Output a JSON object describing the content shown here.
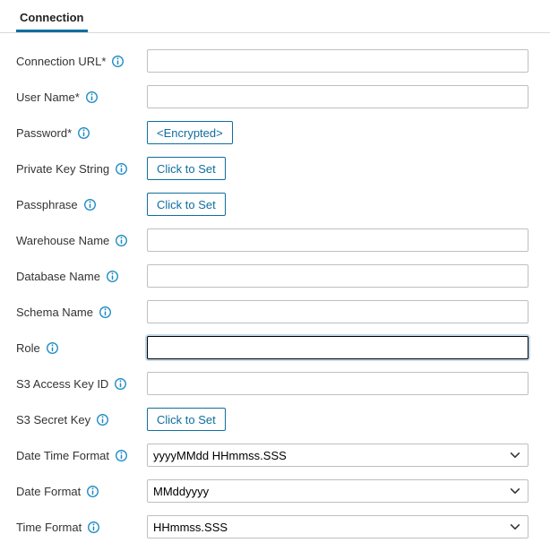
{
  "tabs": {
    "connection": "Connection"
  },
  "labels": {
    "connection_url": "Connection URL*",
    "user_name": "User Name*",
    "password": "Password*",
    "private_key_string": "Private Key String",
    "passphrase": "Passphrase",
    "warehouse_name": "Warehouse Name",
    "database_name": "Database Name",
    "schema_name": "Schema Name",
    "role": "Role",
    "s3_access_key_id": "S3 Access Key ID",
    "s3_secret_key": "S3 Secret Key",
    "date_time_format": "Date Time Format",
    "date_format": "Date Format",
    "time_format": "Time Format"
  },
  "values": {
    "connection_url": "",
    "user_name": "",
    "password_button": "<Encrypted>",
    "private_key_string_button": "Click to Set",
    "passphrase_button": "Click to Set",
    "warehouse_name": "",
    "database_name": "",
    "schema_name": "",
    "role": "",
    "s3_access_key_id": "",
    "s3_secret_key_button": "Click to Set",
    "date_time_format": "yyyyMMdd HHmmss.SSS",
    "date_format": "MMddyyyy",
    "time_format": "HHmmss.SSS"
  },
  "colors": {
    "accent": "#0f6e9e",
    "border": "#bfbfbf"
  }
}
